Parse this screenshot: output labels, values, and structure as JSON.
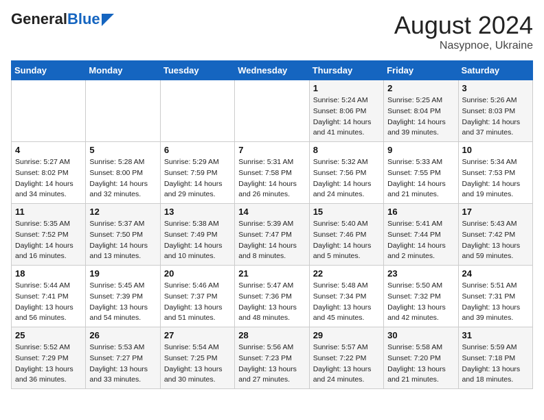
{
  "header": {
    "logo_line1": "General",
    "logo_line2": "Blue",
    "title": "August 2024",
    "location": "Nasypnoe, Ukraine"
  },
  "days_of_week": [
    "Sunday",
    "Monday",
    "Tuesday",
    "Wednesday",
    "Thursday",
    "Friday",
    "Saturday"
  ],
  "weeks": [
    [
      {
        "day": "",
        "info": ""
      },
      {
        "day": "",
        "info": ""
      },
      {
        "day": "",
        "info": ""
      },
      {
        "day": "",
        "info": ""
      },
      {
        "day": "1",
        "info": "Sunrise: 5:24 AM\nSunset: 8:06 PM\nDaylight: 14 hours\nand 41 minutes."
      },
      {
        "day": "2",
        "info": "Sunrise: 5:25 AM\nSunset: 8:04 PM\nDaylight: 14 hours\nand 39 minutes."
      },
      {
        "day": "3",
        "info": "Sunrise: 5:26 AM\nSunset: 8:03 PM\nDaylight: 14 hours\nand 37 minutes."
      }
    ],
    [
      {
        "day": "4",
        "info": "Sunrise: 5:27 AM\nSunset: 8:02 PM\nDaylight: 14 hours\nand 34 minutes."
      },
      {
        "day": "5",
        "info": "Sunrise: 5:28 AM\nSunset: 8:00 PM\nDaylight: 14 hours\nand 32 minutes."
      },
      {
        "day": "6",
        "info": "Sunrise: 5:29 AM\nSunset: 7:59 PM\nDaylight: 14 hours\nand 29 minutes."
      },
      {
        "day": "7",
        "info": "Sunrise: 5:31 AM\nSunset: 7:58 PM\nDaylight: 14 hours\nand 26 minutes."
      },
      {
        "day": "8",
        "info": "Sunrise: 5:32 AM\nSunset: 7:56 PM\nDaylight: 14 hours\nand 24 minutes."
      },
      {
        "day": "9",
        "info": "Sunrise: 5:33 AM\nSunset: 7:55 PM\nDaylight: 14 hours\nand 21 minutes."
      },
      {
        "day": "10",
        "info": "Sunrise: 5:34 AM\nSunset: 7:53 PM\nDaylight: 14 hours\nand 19 minutes."
      }
    ],
    [
      {
        "day": "11",
        "info": "Sunrise: 5:35 AM\nSunset: 7:52 PM\nDaylight: 14 hours\nand 16 minutes."
      },
      {
        "day": "12",
        "info": "Sunrise: 5:37 AM\nSunset: 7:50 PM\nDaylight: 14 hours\nand 13 minutes."
      },
      {
        "day": "13",
        "info": "Sunrise: 5:38 AM\nSunset: 7:49 PM\nDaylight: 14 hours\nand 10 minutes."
      },
      {
        "day": "14",
        "info": "Sunrise: 5:39 AM\nSunset: 7:47 PM\nDaylight: 14 hours\nand 8 minutes."
      },
      {
        "day": "15",
        "info": "Sunrise: 5:40 AM\nSunset: 7:46 PM\nDaylight: 14 hours\nand 5 minutes."
      },
      {
        "day": "16",
        "info": "Sunrise: 5:41 AM\nSunset: 7:44 PM\nDaylight: 14 hours\nand 2 minutes."
      },
      {
        "day": "17",
        "info": "Sunrise: 5:43 AM\nSunset: 7:42 PM\nDaylight: 13 hours\nand 59 minutes."
      }
    ],
    [
      {
        "day": "18",
        "info": "Sunrise: 5:44 AM\nSunset: 7:41 PM\nDaylight: 13 hours\nand 56 minutes."
      },
      {
        "day": "19",
        "info": "Sunrise: 5:45 AM\nSunset: 7:39 PM\nDaylight: 13 hours\nand 54 minutes."
      },
      {
        "day": "20",
        "info": "Sunrise: 5:46 AM\nSunset: 7:37 PM\nDaylight: 13 hours\nand 51 minutes."
      },
      {
        "day": "21",
        "info": "Sunrise: 5:47 AM\nSunset: 7:36 PM\nDaylight: 13 hours\nand 48 minutes."
      },
      {
        "day": "22",
        "info": "Sunrise: 5:48 AM\nSunset: 7:34 PM\nDaylight: 13 hours\nand 45 minutes."
      },
      {
        "day": "23",
        "info": "Sunrise: 5:50 AM\nSunset: 7:32 PM\nDaylight: 13 hours\nand 42 minutes."
      },
      {
        "day": "24",
        "info": "Sunrise: 5:51 AM\nSunset: 7:31 PM\nDaylight: 13 hours\nand 39 minutes."
      }
    ],
    [
      {
        "day": "25",
        "info": "Sunrise: 5:52 AM\nSunset: 7:29 PM\nDaylight: 13 hours\nand 36 minutes."
      },
      {
        "day": "26",
        "info": "Sunrise: 5:53 AM\nSunset: 7:27 PM\nDaylight: 13 hours\nand 33 minutes."
      },
      {
        "day": "27",
        "info": "Sunrise: 5:54 AM\nSunset: 7:25 PM\nDaylight: 13 hours\nand 30 minutes."
      },
      {
        "day": "28",
        "info": "Sunrise: 5:56 AM\nSunset: 7:23 PM\nDaylight: 13 hours\nand 27 minutes."
      },
      {
        "day": "29",
        "info": "Sunrise: 5:57 AM\nSunset: 7:22 PM\nDaylight: 13 hours\nand 24 minutes."
      },
      {
        "day": "30",
        "info": "Sunrise: 5:58 AM\nSunset: 7:20 PM\nDaylight: 13 hours\nand 21 minutes."
      },
      {
        "day": "31",
        "info": "Sunrise: 5:59 AM\nSunset: 7:18 PM\nDaylight: 13 hours\nand 18 minutes."
      }
    ]
  ]
}
